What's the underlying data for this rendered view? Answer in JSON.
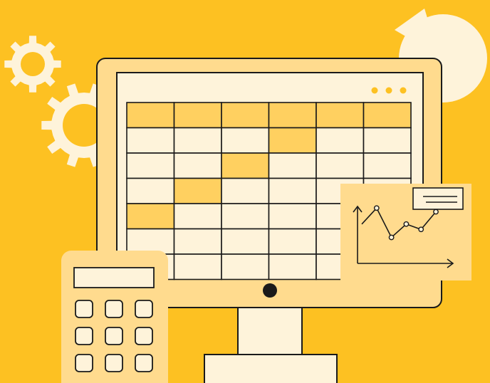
{
  "illustration": {
    "theme": "spreadsheet-on-monitor",
    "colors": {
      "background": "#FDC122",
      "cream": "#FEF3DA",
      "monitor_frame": "#FFDB8E",
      "highlight_cell": "#FFD060",
      "outline": "#1A1A1A"
    },
    "icons": [
      "gear-icon",
      "pie-chart-icon",
      "monitor-icon",
      "spreadsheet-grid",
      "line-chart-card",
      "calculator-icon"
    ],
    "spreadsheet": {
      "rows": 7,
      "cols": 6,
      "highlighted_cells": [
        [
          0,
          0
        ],
        [
          0,
          1
        ],
        [
          0,
          2
        ],
        [
          0,
          3
        ],
        [
          0,
          4
        ],
        [
          0,
          5
        ],
        [
          1,
          3
        ],
        [
          2,
          2
        ],
        [
          3,
          1
        ],
        [
          4,
          0
        ]
      ]
    },
    "line_chart": {
      "points": [
        {
          "x": 1,
          "y": 0.55
        },
        {
          "x": 2,
          "y": 0.85
        },
        {
          "x": 3,
          "y": 0.3
        },
        {
          "x": 4,
          "y": 0.55
        },
        {
          "x": 5,
          "y": 0.45
        },
        {
          "x": 6,
          "y": 0.78
        }
      ]
    },
    "calculator": {
      "keys_rows": 3,
      "keys_cols": 3
    }
  }
}
